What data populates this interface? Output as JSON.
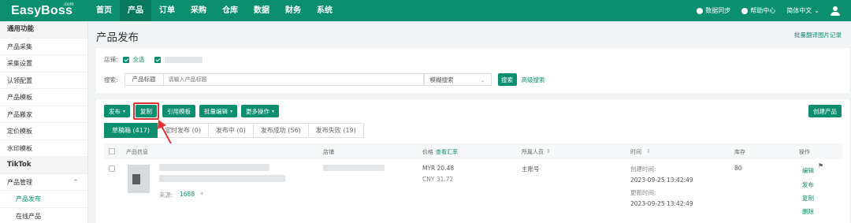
{
  "logo": {
    "text": "EasyBoss",
    "sup": ".com"
  },
  "nav": [
    "首页",
    "产品",
    "订单",
    "采购",
    "仓库",
    "数据",
    "财务",
    "系统"
  ],
  "topright": {
    "sync": "数据同步",
    "help": "帮助中心",
    "lang": "简体中文"
  },
  "sidebar": {
    "items": [
      "通用功能",
      "产品采集",
      "采集设置",
      "认领配置",
      "产品模板",
      "产品搬家",
      "定价模板",
      "水印模板",
      "TikTok",
      "产品管理",
      "产品发布",
      "在线产品"
    ]
  },
  "page": {
    "title": "产品发布",
    "top_link": "批量翻译图片记录"
  },
  "filter": {
    "shop_label": "店铺:",
    "all_label": "全选",
    "search_label": "搜索:",
    "search_field": "产品标题",
    "search_placeholder": "请输入产品标题",
    "mode": "模糊搜索",
    "search_btn": "搜索",
    "advanced": "高级搜索"
  },
  "toolbar": {
    "publish": "发布",
    "copy": "复制",
    "use_template": "引用模板",
    "batch_edit": "批量编辑",
    "more": "更多操作",
    "create": "创建产品"
  },
  "tabs": [
    "草稿箱 (417)",
    "定时发布 (0)",
    "发布中 (0)",
    "发布成功 (56)",
    "发布失败 (19)"
  ],
  "table": {
    "headers": {
      "info": "产品信息",
      "shop": "店铺",
      "price": "价格",
      "rate": "查看汇率",
      "staff": "所属人员",
      "time": "时间",
      "stock": "库存",
      "action": "操作"
    },
    "rows": [
      {
        "source_label": "来源:",
        "source": "1688",
        "price_myr": "MYR 20.48",
        "price_cny": "CNY 31.72",
        "staff": "主账号",
        "created_label": "创建时间:",
        "created": "2023-09-25 13:42:49",
        "updated_label": "更新时间:",
        "updated": "2023-09-25 13:42:49",
        "stock": "80",
        "actions": [
          "编辑",
          "发布",
          "复制",
          "删除"
        ]
      }
    ]
  },
  "colors": {
    "brand": "#0b8f6e",
    "highlight": "#e03434"
  }
}
